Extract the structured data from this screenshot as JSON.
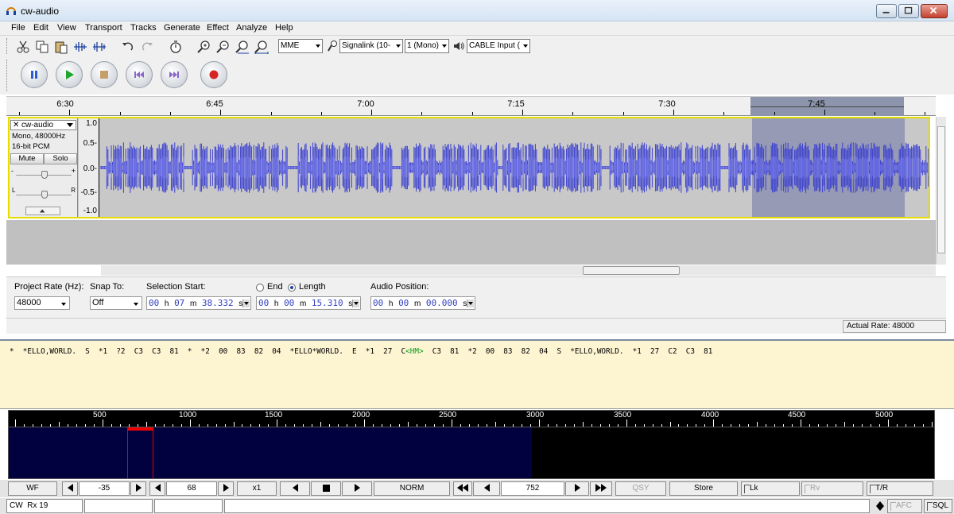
{
  "window": {
    "title": "cw-audio"
  },
  "menu": [
    "File",
    "Edit",
    "View",
    "Transport",
    "Tracks",
    "Generate",
    "Effect",
    "Analyze",
    "Help"
  ],
  "device": {
    "host": "MME",
    "recording_device": "Signalink (10-",
    "channels": "1 (Mono)",
    "playback_device": "CABLE Input ("
  },
  "timeline": {
    "labels": [
      "6:30",
      "6:45",
      "7:00",
      "7:15",
      "7:30",
      "7:45"
    ]
  },
  "track": {
    "name": "cw-audio",
    "info1": "Mono, 48000Hz",
    "info2": "16-bit PCM",
    "mute": "Mute",
    "solo": "Solo",
    "gain_minus": "-",
    "gain_plus": "+",
    "pan_left": "L",
    "pan_right": "R",
    "scale": [
      "1.0",
      "0.5-",
      "0.0-",
      "-0.5-",
      "-1.0"
    ]
  },
  "selection_bar": {
    "project_rate_label": "Project Rate (Hz):",
    "project_rate": "48000",
    "snap_label": "Snap To:",
    "snap_value": "Off",
    "sel_start_label": "Selection Start:",
    "end_label": "End",
    "length_label": "Length",
    "audio_pos_label": "Audio Position:",
    "sel_start": {
      "h": "00",
      "m": "07",
      "s": "38.332"
    },
    "length": {
      "h": "00",
      "m": "00",
      "s": "15.310"
    },
    "audio_pos": {
      "h": "00",
      "m": "00",
      "s": "00.000"
    },
    "unit_h": "h",
    "unit_m": "m",
    "unit_s": "s"
  },
  "status": {
    "actual_rate": "Actual Rate: 48000"
  },
  "fldigi": {
    "rx_before": "*  *ELLO,WORLD.  S  *1  ?2  C3  C3  81  *  *2  00  83  82  04  *ELLO*WORLD.  E  *1  27  C",
    "rx_highlight": "<HM>",
    "rx_after": "  C3  81  *2  00  83  82  04  S  *ELLO,WORLD.  *1  27  C2  C3  81",
    "scale_labels": [
      "500",
      "1000",
      "1500",
      "2000",
      "2500",
      "3000",
      "3500",
      "4000",
      "4500",
      "5000"
    ],
    "controls": {
      "wf": "WF",
      "ref_level": "-35",
      "ampl_span": "68",
      "zoom": "x1",
      "norm": "NORM",
      "freq": "752",
      "qsy": "QSY",
      "store": "Store",
      "lk": "Lk",
      "rv": "Rv",
      "tr": "T/R",
      "afc": "AFC",
      "sql": "SQL"
    },
    "mode": "CW",
    "rx_label": "Rx 19"
  },
  "colors": {
    "waveform": "#3a3fd0",
    "selection": "#969ab5",
    "track_border": "#e4df00",
    "rx_background": "#fdf4d2",
    "waterfall_active": "#01013f",
    "waterfall_cursor": "#dd0000"
  }
}
